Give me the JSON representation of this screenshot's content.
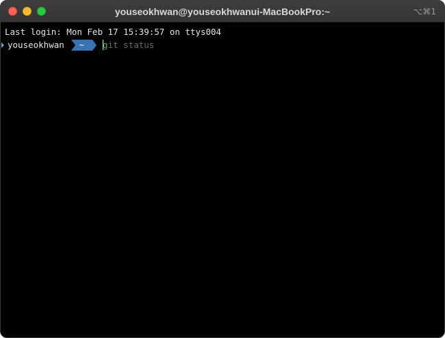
{
  "window": {
    "title": "youseokhwan@youseokhwanui-MacBookPro:~",
    "shortcut": "⌥⌘1",
    "colors": {
      "close": "#fe5f57",
      "minimize": "#febc2e",
      "zoom": "#28c840",
      "background": "#000000"
    }
  },
  "terminal": {
    "last_login": "Last login: Mon Feb 17 15:39:57 on ttys004",
    "prompt": {
      "user": "youseokhwan",
      "path": "~",
      "path_color": "#3873b5"
    },
    "command": {
      "typed": "g",
      "suggestion": "it status"
    }
  }
}
